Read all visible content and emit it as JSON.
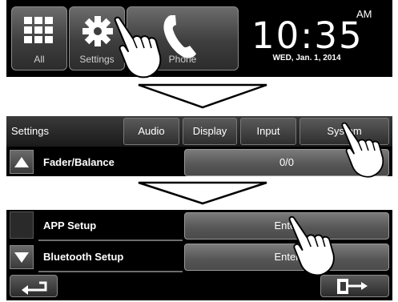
{
  "home": {
    "items": [
      {
        "label": "All",
        "icon": "grid-icon"
      },
      {
        "label": "Settings",
        "icon": "gear-icon"
      },
      {
        "label": "Phone",
        "icon": "phone-icon"
      }
    ],
    "clock": {
      "ampm": "AM",
      "time": "10:35",
      "date": "WED, Jan. 1, 2014"
    }
  },
  "settings": {
    "title": "Settings",
    "tabs": [
      {
        "label": "Audio"
      },
      {
        "label": "Display"
      },
      {
        "label": "Input"
      },
      {
        "label": "System"
      }
    ],
    "rows": [
      {
        "label": "Fader/Balance",
        "value": "0/0"
      }
    ]
  },
  "system": {
    "rows": [
      {
        "label": "APP Setup",
        "value": "Enter"
      },
      {
        "label": "Bluetooth Setup",
        "value": "Enter"
      }
    ],
    "icons": [
      "back-icon",
      "exit-icon",
      "scroll-up-icon",
      "scroll-down-icon"
    ]
  },
  "colors": {
    "panel": "#000000",
    "button": "#4a4a4a",
    "text": "#ffffff"
  }
}
